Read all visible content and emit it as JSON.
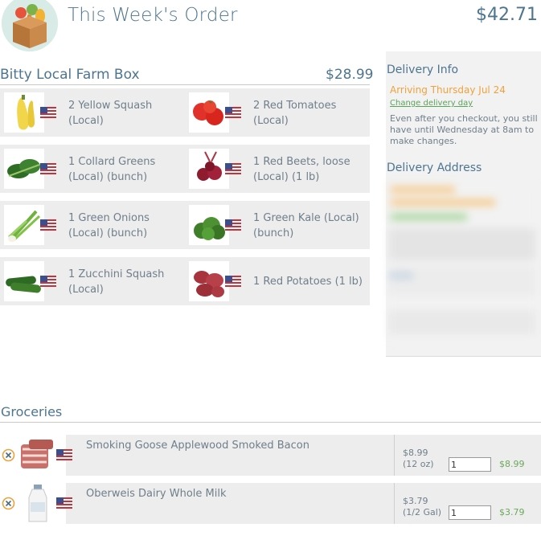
{
  "header": {
    "title": "This Week's Order",
    "total": "$42.71"
  },
  "box": {
    "title": "Bitty Local Farm Box",
    "price": "$28.99",
    "items": [
      {
        "name": "2 Yellow Squash (Local)",
        "icon": "yellow-squash"
      },
      {
        "name": "2 Red Tomatoes (Local)",
        "icon": "red-tomatoes"
      },
      {
        "name": "1 Collard Greens (Local) (bunch)",
        "icon": "collard-greens"
      },
      {
        "name": "1 Red Beets, loose (Local) (1 lb)",
        "icon": "red-beets"
      },
      {
        "name": "1 Green Onions (Local) (bunch)",
        "icon": "green-onions"
      },
      {
        "name": "1 Green Kale (Local) (bunch)",
        "icon": "green-kale"
      },
      {
        "name": "1 Zucchini Squash (Local)",
        "icon": "zucchini"
      },
      {
        "name": "1 Red Potatoes (1 lb)",
        "icon": "red-potatoes"
      }
    ]
  },
  "delivery": {
    "title": "Delivery Info",
    "arriving": "Arriving Thursday Jul 24",
    "change_link": "Change delivery day",
    "note": "Even after you checkout, you still have until Wednesday at 8am to make changes.",
    "address_title": "Delivery Address"
  },
  "groceries": {
    "title": "Groceries",
    "items": [
      {
        "name": "Smoking Goose Applewood Smoked Bacon",
        "price": "$8.99",
        "unit": "(12 oz)",
        "qty": "1",
        "total": "$8.99",
        "icon": "bacon"
      },
      {
        "name": "Oberweis Dairy Whole Milk",
        "price": "$3.79",
        "unit": "(1/2 Gal)",
        "qty": "1",
        "total": "$3.79",
        "icon": "milk-bottle"
      }
    ]
  },
  "colors": {
    "accent": "#4d7590",
    "orange": "#f0a23a",
    "green": "#6ba85a",
    "row_bg": "#ededed"
  }
}
